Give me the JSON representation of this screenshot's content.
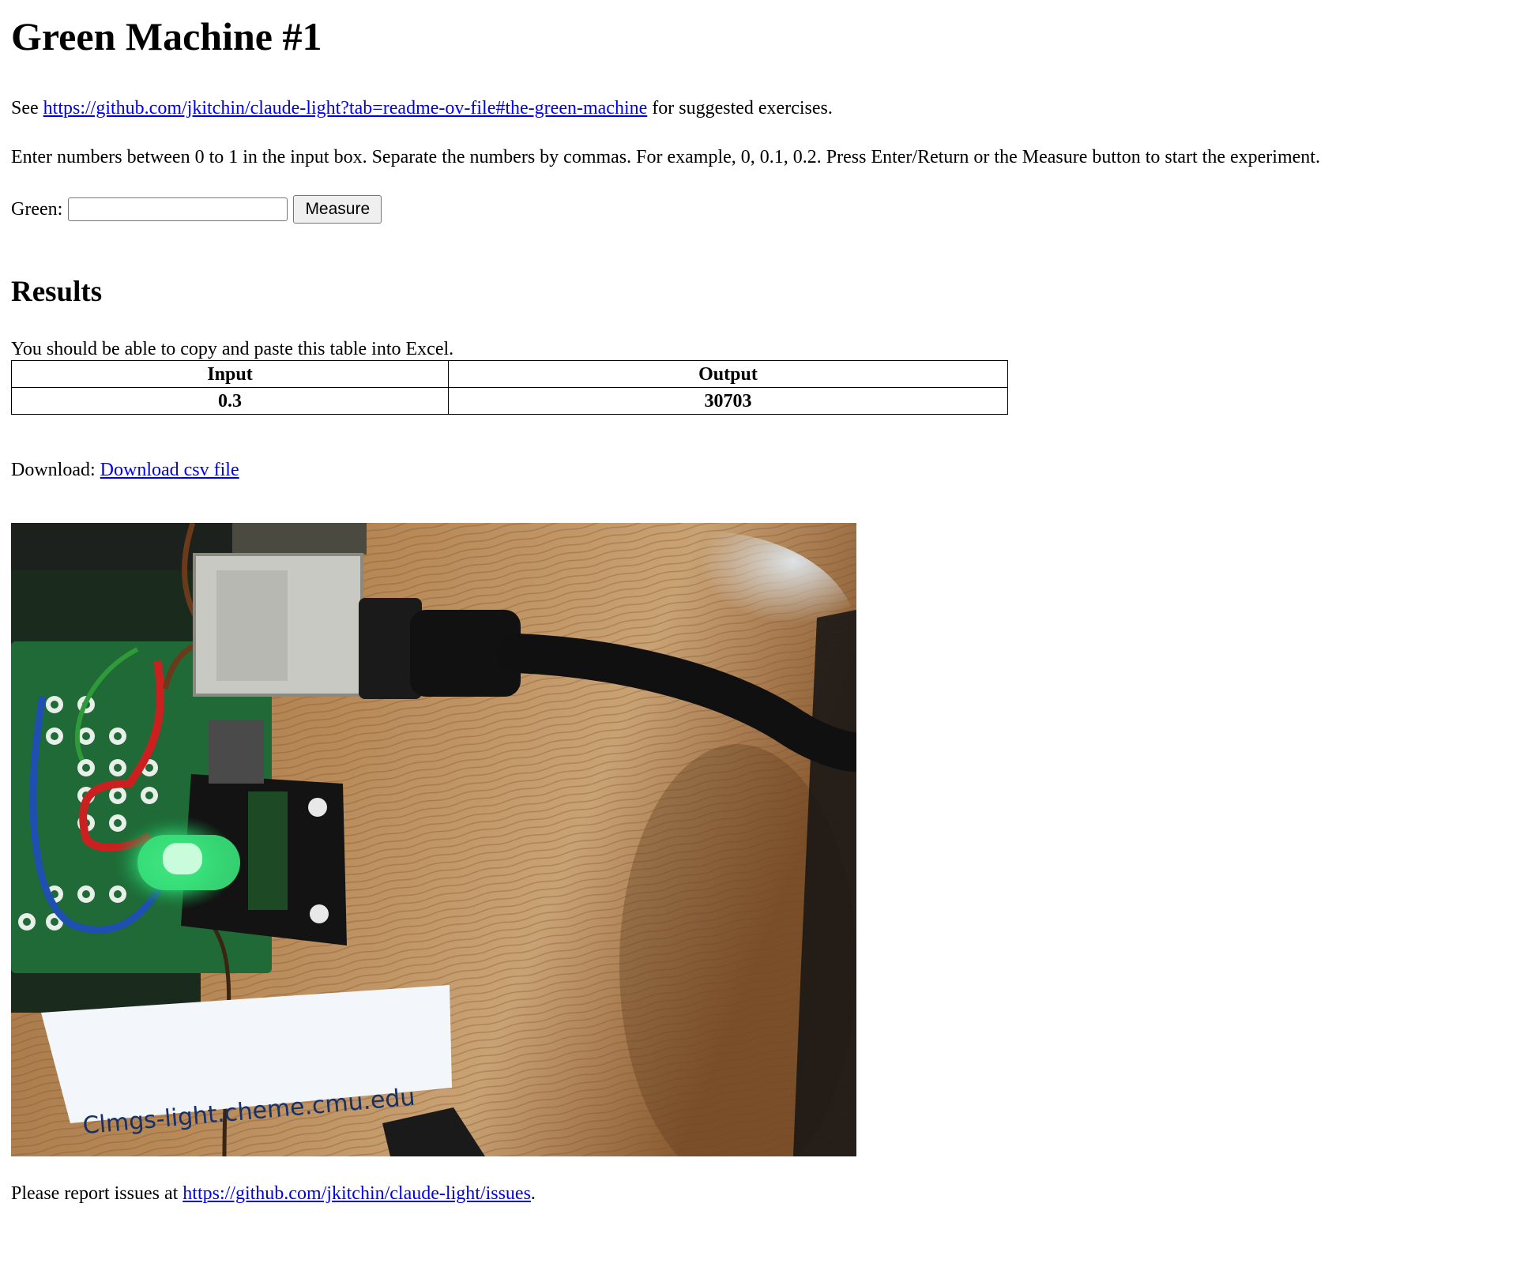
{
  "page": {
    "title": "Green Machine #1",
    "see_prefix": "See",
    "see_link": "https://github.com/jkitchin/claude-light?tab=readme-ov-file#the-green-machine",
    "see_suffix": "for suggested exercises.",
    "instructions": "Enter numbers between 0 to 1 in the input box. Separate the numbers by commas. For example, 0, 0.1, 0.2. Press Enter/Return or the Measure button to start the experiment."
  },
  "form": {
    "green_label": "Green:",
    "green_value": "",
    "measure_label": "Measure"
  },
  "results": {
    "heading": "Results",
    "note": "You should be able to copy and paste this table into Excel.",
    "columns": [
      "Input",
      "Output"
    ],
    "rows": [
      [
        "0.3",
        "30703"
      ]
    ]
  },
  "download": {
    "label": "Download:",
    "link_text": "Download csv file"
  },
  "photo": {
    "label_text": "Clmgs-light.cheme.cmu.edu",
    "led_color": "#38e07a"
  },
  "footer": {
    "prefix": "Please report issues at",
    "link": "https://github.com/jkitchin/claude-light/issues",
    "suffix": "."
  }
}
